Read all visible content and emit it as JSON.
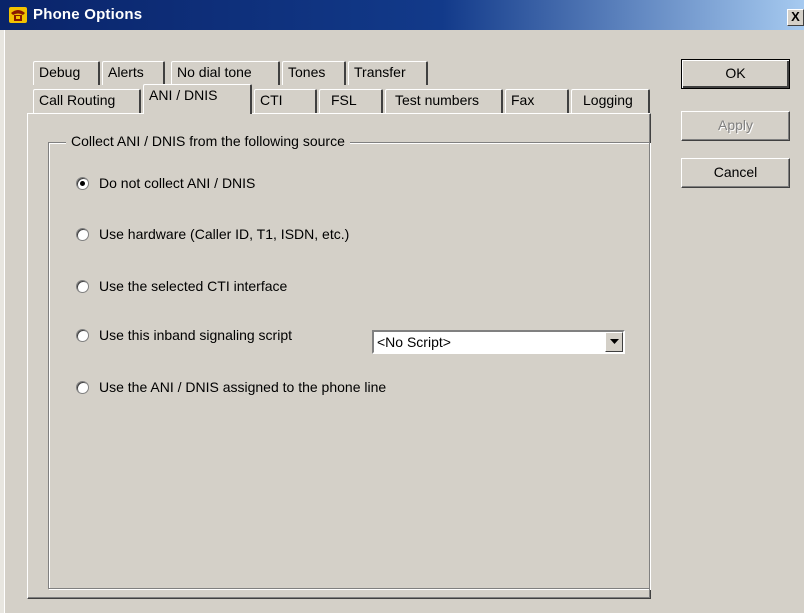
{
  "window": {
    "title": "Phone Options",
    "close_label": "X"
  },
  "tabs": {
    "row1": [
      "Debug",
      "Alerts",
      "No dial tone",
      "Tones",
      "Transfer"
    ],
    "row2": [
      "Call Routing",
      "ANI / DNIS",
      "CTI",
      "FSL",
      "Test numbers",
      "Fax",
      "Logging"
    ],
    "active": "ANI / DNIS"
  },
  "group": {
    "legend": "Collect ANI / DNIS  from the following source",
    "options": [
      {
        "label": "Do not collect ANI / DNIS",
        "checked": true
      },
      {
        "label": "Use hardware (Caller ID, T1, ISDN, etc.)",
        "checked": false
      },
      {
        "label": "Use the selected CTI interface",
        "checked": false
      },
      {
        "label": "Use this inband signaling script",
        "checked": false
      },
      {
        "label": "Use the ANI / DNIS assigned to the phone line",
        "checked": false
      }
    ],
    "script_select": {
      "value": "<No Script>"
    }
  },
  "buttons": {
    "ok": "OK",
    "apply": "Apply",
    "cancel": "Cancel"
  },
  "colors": {
    "face": "#d4d0c8",
    "title_start": "#0a246a",
    "title_end": "#a6caf0"
  },
  "icons": {
    "title": "phone-icon",
    "close": "close-icon",
    "dropdown": "chevron-down-icon"
  }
}
